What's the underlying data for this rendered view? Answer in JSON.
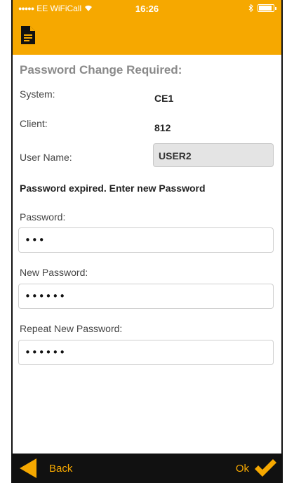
{
  "status_bar": {
    "carrier": "EE WiFiCall",
    "time": "16:26"
  },
  "app": {
    "page_title": "Password Change Required:",
    "system_label": "System:",
    "system_value": "CE1",
    "client_label": "Client:",
    "client_value": "812",
    "username_label": "User Name:",
    "username_value": "USER2",
    "notice": "Password expired.  Enter new Password",
    "password_label": "Password:",
    "password_value": "•••",
    "new_password_label": "New Password:",
    "new_password_value": "••••••",
    "repeat_password_label": "Repeat New Password:",
    "repeat_password_value": "••••••"
  },
  "bottom_bar": {
    "back_label": "Back",
    "ok_label": "Ok"
  },
  "colors": {
    "accent": "#f6a800",
    "bottom_bar": "#111111"
  }
}
